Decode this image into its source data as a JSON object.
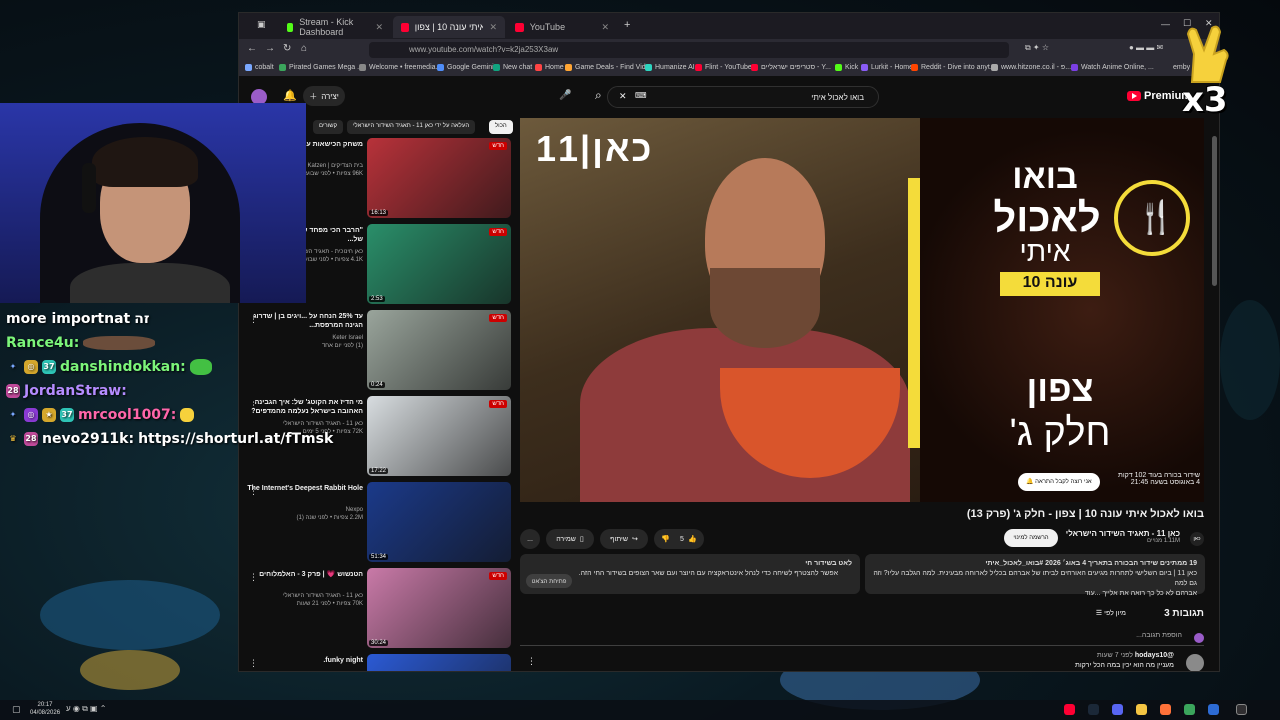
{
  "browser": {
    "tabs": [
      {
        "label": "Stream - Kick Dashboard",
        "color": "#53fc18"
      },
      {
        "label": "בואו לאכול איתי עונה 10 | צפון",
        "color": "#ff0033"
      },
      {
        "label": "YouTube",
        "color": "#ff0033"
      }
    ],
    "url": "www.youtube.com/watch?v=k2ja253X3aw",
    "bookmarks": [
      "cobalt",
      "Pirated Games Mega ...",
      "Welcome • freemedia...",
      "Google Gemini",
      "New chat",
      "Home",
      "Game Deals - Find Vid...",
      "Humanize AI",
      "Flint - YouTube",
      "סטריפים ישראליים - Y...",
      "Kick",
      "Lurkit - Home",
      "Reddit - Dive into anyt...",
      "www.hitzone.co.il - פ...",
      "Watch Anime Online, ...",
      "emby"
    ]
  },
  "youtube": {
    "search_value": "בואו לאכול איתי",
    "logo_text": "Premium",
    "create_label": "יצירה",
    "chips": [
      "הכול",
      "העלאה על ידי כאן 11 - תאגיד השידור הישראלי",
      "קשורים"
    ],
    "player": {
      "channel_logo": "כאן|11",
      "promo_line1": "בואו",
      "promo_line2": "לאכול",
      "promo_line3": "איתי",
      "season_badge": "עונה 10",
      "location": "צפון",
      "part": "חלק ג'",
      "upcoming_line1": "שידור בכורה בעוד 102 דקות",
      "upcoming_line2": "4 באוגוסט בשעה 21:45",
      "notify_label": "אני רוצה לקבל התראה"
    },
    "video_title": "בואו לאכול איתי עונה 10 | צפון - חלק ג' (פרק 13)",
    "channel_name": "כאן 11 - תאגיד השידור הישראלי",
    "channel_subs": "1.11M מנויים",
    "subscribe_label": "הרשמה למינוי",
    "join_label": "כאן",
    "like_count": "5",
    "share_label": "שיתוף",
    "save_label": "שמירה",
    "more_label": "...",
    "description": {
      "line1": "19 ממתינים  שידור הבכורה בתאריך 4 באוג׳ 2026  #בואו_לאכול_איתי",
      "line2": "כאן 11 | ביום השלישי לתחרות מגיעים האורחים לביתו של אברהם בכליל לארוחה מבעינית. למה הגלבה עליו? וזה גם למה",
      "line3": "אברהם לא כל כך רואה את אלייך ...עוד"
    },
    "live_chat": {
      "title": "לאט בשידור חי",
      "text": "אפשר להצטרף לשיחה כדי לנהל אינטראקציה עם היוצר ועם שאר הצופים בשידור החי הזה.",
      "button": "פתיחת הצ'אט"
    },
    "comments": {
      "count_label": "3 תגובות",
      "sort_label": "מיון לפי",
      "add_placeholder": "הוספת תגובה...",
      "first_author": "@hodays10",
      "first_time": "לפני 7 שעות",
      "first_text": "מעניין מה הוא יכין במה הכל ירקות"
    },
    "suggestions": [
      {
        "title": "משחק הכישאות עם ... מצרוכר דוד",
        "meta": "בית הצדיקים | al Katzen\n96K צפיות • לפני שבוע",
        "duration": "16:13",
        "thumb": "#b8323a",
        "badge": "חדש"
      },
      {
        "title": "\"הרבר הכי מפחד של הומשא ובוזיקה של...",
        "meta": "כאן חינוכית - תאגיד השידור\n4.1K צפיות • לפני שבוע",
        "duration": "2:53",
        "thumb": "#2a8f6a",
        "badge": "חדש"
      },
      {
        "title": "עד 25% הנחה על ...ויגים בן | שדרוג הגינה המרפסת...",
        "meta": "Keter Israel\n(1) לפני יום אחד",
        "duration": "0:24",
        "thumb": "#9aa59c",
        "badge": "חדש"
      },
      {
        "title": "מי הדיז את הקוטג' של: איך הגבינה האהובה בישראל נעלמה מהמדפים?",
        "meta": "כאן 11 - תאגיד השידור הישראלי\n72K צפיות • לפני 5 ימים",
        "duration": "17:22",
        "thumb": "#d8dde0",
        "badge": "חדש"
      },
      {
        "title": "The Internet's Deepest Rabbit Hole",
        "meta": "Nexpo\n2.2M צפיות • לפני שנה (1)",
        "duration": "51:34",
        "thumb": "#1b3a8a",
        "badge": ""
      },
      {
        "title": "הטנשוש 💗 | פרק 3 - האלמלוחים",
        "meta": "כאן 11 - תאגיד השידור הישראלי\n70K צפיות • לפני 21 שעות",
        "duration": "30:24",
        "thumb": "#c97aa8",
        "badge": "חדש"
      },
      {
        "title": "funky night.",
        "meta": "Sole space\n34 צפיות • לפני 7 חודשים",
        "duration": "",
        "thumb": "#2b5ad4",
        "badge": ""
      }
    ]
  },
  "chat": [
    {
      "user": "more importnat",
      "text": "זה",
      "color": "#ffffff"
    },
    {
      "user": "Rance4u:",
      "text": "",
      "color": "#7cf57a"
    },
    {
      "user": "danshindokkan:",
      "text": "",
      "color": "#7cf57a"
    },
    {
      "user": "JordanStraw:",
      "text": "",
      "color": "#b58cff"
    },
    {
      "user": "mrcool1007:",
      "text": "",
      "color": "#ff66aa"
    },
    {
      "user": "nevo2911k:",
      "text": "https://shorturl.at/fTmsk",
      "color": "#ffffff"
    }
  ],
  "overlay": {
    "multiplier": "x3"
  },
  "taskbar": {
    "time": "20:17",
    "date": "04/08/2026"
  }
}
